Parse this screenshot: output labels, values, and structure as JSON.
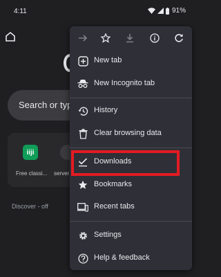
{
  "status_bar": {
    "time": "4:11",
    "battery": "91%"
  },
  "background": {
    "search_placeholder": "Search or typ",
    "shortcuts": [
      {
        "label": "Free classi...",
        "icon_text": "iiji"
      },
      {
        "label": "server"
      }
    ],
    "discover": "Discover - off"
  },
  "menu": {
    "items": [
      {
        "label": "New tab",
        "icon": "plus-box-icon"
      },
      {
        "label": "New Incognito tab",
        "icon": "incognito-icon"
      },
      {
        "label": "History",
        "icon": "history-icon"
      },
      {
        "label": "Clear browsing data",
        "icon": "trash-icon"
      },
      {
        "label": "Downloads",
        "icon": "download-check-icon"
      },
      {
        "label": "Bookmarks",
        "icon": "star-icon"
      },
      {
        "label": "Recent tabs",
        "icon": "devices-icon"
      },
      {
        "label": "Settings",
        "icon": "gear-icon"
      },
      {
        "label": "Help & feedback",
        "icon": "help-icon"
      }
    ]
  },
  "colors": {
    "menu_bg": "#2f2f37",
    "page_bg": "#1f1f22",
    "highlight": "#e31b23"
  }
}
